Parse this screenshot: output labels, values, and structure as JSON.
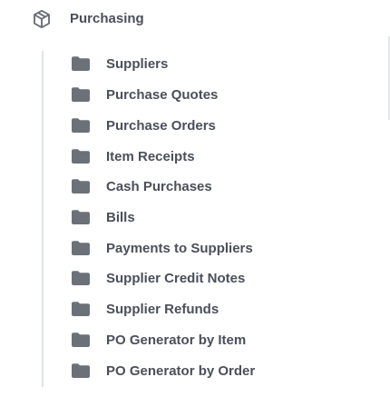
{
  "section": {
    "title": "Purchasing",
    "icon": "cube-icon"
  },
  "items": [
    {
      "label": "Suppliers",
      "icon": "folder-icon"
    },
    {
      "label": "Purchase Quotes",
      "icon": "folder-icon"
    },
    {
      "label": "Purchase Orders",
      "icon": "folder-icon"
    },
    {
      "label": "Item Receipts",
      "icon": "folder-icon"
    },
    {
      "label": "Cash Purchases",
      "icon": "folder-icon"
    },
    {
      "label": "Bills",
      "icon": "folder-icon"
    },
    {
      "label": "Payments to Suppliers",
      "icon": "folder-icon"
    },
    {
      "label": "Supplier Credit Notes",
      "icon": "folder-icon"
    },
    {
      "label": "Supplier Refunds",
      "icon": "folder-icon"
    },
    {
      "label": "PO Generator by Item",
      "icon": "folder-icon"
    },
    {
      "label": "PO Generator by Order",
      "icon": "folder-icon"
    }
  ],
  "colors": {
    "text": "#4a4f5a",
    "icon": "#6b7079",
    "guide_line": "#e0e2e6"
  }
}
